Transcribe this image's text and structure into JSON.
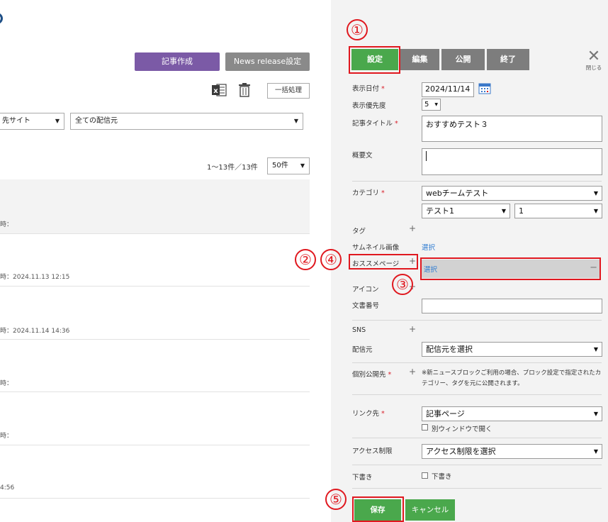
{
  "left": {
    "create_button": "記事作成",
    "news_release_button": "News release設定",
    "bulk_button": "一括処理",
    "site_select": "先サイト",
    "source_select": "全ての配信元",
    "count_text": "1～13件／13件",
    "per_page": "50件",
    "rows": [
      {
        "text": "時："
      },
      {
        "text": "時：2024.11.13 12:15"
      },
      {
        "text": "時：2024.11.14 14:36"
      },
      {
        "text": "時："
      },
      {
        "text": "時："
      },
      {
        "text": "4:56"
      }
    ]
  },
  "right": {
    "tabs": [
      {
        "label": "設定"
      },
      {
        "label": "編集"
      },
      {
        "label": "公開"
      },
      {
        "label": "終了"
      }
    ],
    "close_label": "閉じる",
    "fields": {
      "display_date_label": "表示日付",
      "display_date_value": "2024/11/14",
      "priority_label": "表示優先度",
      "priority_value": "5",
      "title_label": "記事タイトル",
      "title_value": "おすすめテスト３",
      "summary_label": "概要文",
      "category_label": "カテゴリ",
      "category_value": "webチームテスト",
      "category_sub_value": "テスト1",
      "category_num_value": "1",
      "tag_label": "タグ",
      "thumbnail_label": "サムネイル画像",
      "thumbnail_link": "選択",
      "recommended_label": "おススメページ",
      "recommended_link": "選択",
      "icon_label": "アイコン",
      "doc_number_label": "文書番号",
      "sns_label": "SNS",
      "source_label": "配信元",
      "source_value": "配信元を選択",
      "public_to_label": "個別公開先",
      "public_to_note": "※新ニュースブロックご利用の場合、ブロック設定で指定されたカテゴリー、タグを元に公開されます。",
      "link_label": "リンク先",
      "link_value": "記事ページ",
      "new_window_label": "別ウィンドウで開く",
      "access_label": "アクセス制限",
      "access_value": "アクセス制限を選択",
      "draft_label": "下書き",
      "draft_checkbox_label": "下書き",
      "required_mark": "*"
    },
    "save_button": "保存",
    "cancel_button": "キャンセル"
  },
  "annotations": {
    "one": "①",
    "two": "②",
    "three": "③",
    "four": "④",
    "five": "⑤"
  },
  "colors": {
    "green": "#4aa84c",
    "purple": "#7b5aa6",
    "red": "#e0181f",
    "link": "#2e7bd1"
  }
}
